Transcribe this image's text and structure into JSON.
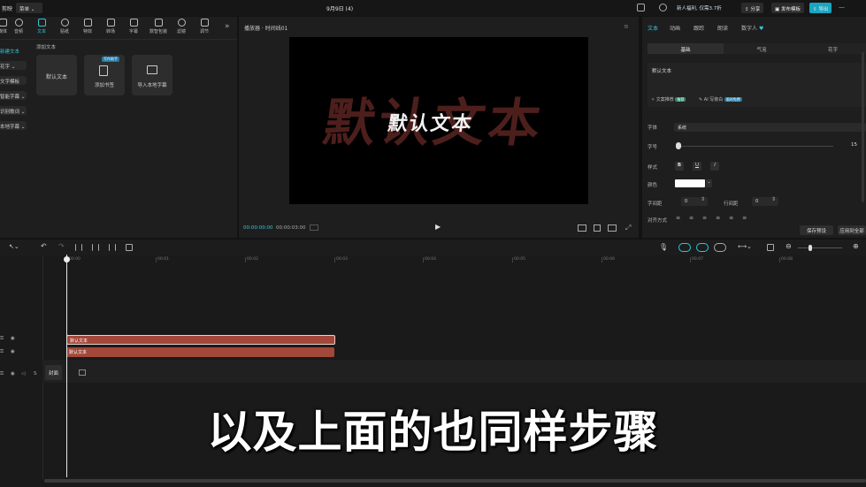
{
  "app": {
    "logo": "剪映",
    "mode_dropdown": "菜单",
    "project_title": "9月9日 (4)",
    "promo": "新人福利, 仅需3.7折",
    "share": "分享",
    "publish": "发布模板",
    "export": "导出"
  },
  "toolbar": {
    "items": [
      {
        "label": "媒体",
        "icon": "media-icon"
      },
      {
        "label": "音频",
        "icon": "audio-icon"
      },
      {
        "label": "文本",
        "icon": "text-icon"
      },
      {
        "label": "贴纸",
        "icon": "sticker-icon"
      },
      {
        "label": "特效",
        "icon": "effects-icon"
      },
      {
        "label": "转场",
        "icon": "transition-icon"
      },
      {
        "label": "字幕",
        "icon": "caption-icon"
      },
      {
        "label": "数智包装",
        "icon": "package-icon"
      },
      {
        "label": "滤镜",
        "icon": "filter-icon"
      },
      {
        "label": "调节",
        "icon": "adjust-icon"
      }
    ],
    "more": "»"
  },
  "sidebar": {
    "items": [
      "新建文本",
      "花字",
      "文字模板",
      "智能字幕",
      "识别歌词",
      "本地字幕"
    ]
  },
  "library": {
    "section_title": "添加文本",
    "tiles": [
      {
        "label": "默认文本"
      },
      {
        "label": "添加书签",
        "badge": "写作助手"
      },
      {
        "label": "导入本地字幕"
      }
    ]
  },
  "player": {
    "title": "播放器 · 时间线01",
    "preview_text_bg": "默认文本",
    "preview_text_fg": "默认文本",
    "time_current": "00:00:00:00",
    "time_total": "00:00:03:00"
  },
  "inspector": {
    "tabs": [
      "文本",
      "动画",
      "跟踪",
      "朗读",
      "数字人"
    ],
    "subtabs": [
      "基础",
      "气泡",
      "花字"
    ],
    "text_value": "默认文本",
    "ai_options": [
      "文案推荐",
      "AI 写旁白"
    ],
    "ai_badges": [
      "推荐",
      "限时免费"
    ],
    "font_label": "字体",
    "font_value": "系统",
    "size_label": "字号",
    "size_value": "15",
    "style_label": "样式",
    "style_buttons": [
      "B",
      "U",
      "I"
    ],
    "color_label": "颜色",
    "color_value": "#ffffff",
    "letter_spacing_label": "字间距",
    "letter_spacing_value": "0",
    "line_spacing_label": "行间距",
    "line_spacing_value": "0",
    "align_label": "对齐方式",
    "save_preset": "保存预设",
    "apply_all": "应用到全部"
  },
  "timeline": {
    "ruler_ticks": [
      "00:00",
      "00:01",
      "00:02",
      "00:03",
      "00:04",
      "00:05",
      "00:06",
      "00:07",
      "00:08"
    ],
    "clips": [
      {
        "label": "默认文本"
      },
      {
        "label": "默认文本"
      }
    ],
    "cover_label": "封面",
    "subtitle": "以及上面的也同样步骤"
  },
  "colors": {
    "accent": "#34c6d8",
    "clip": "#a2473a",
    "export_btn": "#1aa5c0"
  }
}
